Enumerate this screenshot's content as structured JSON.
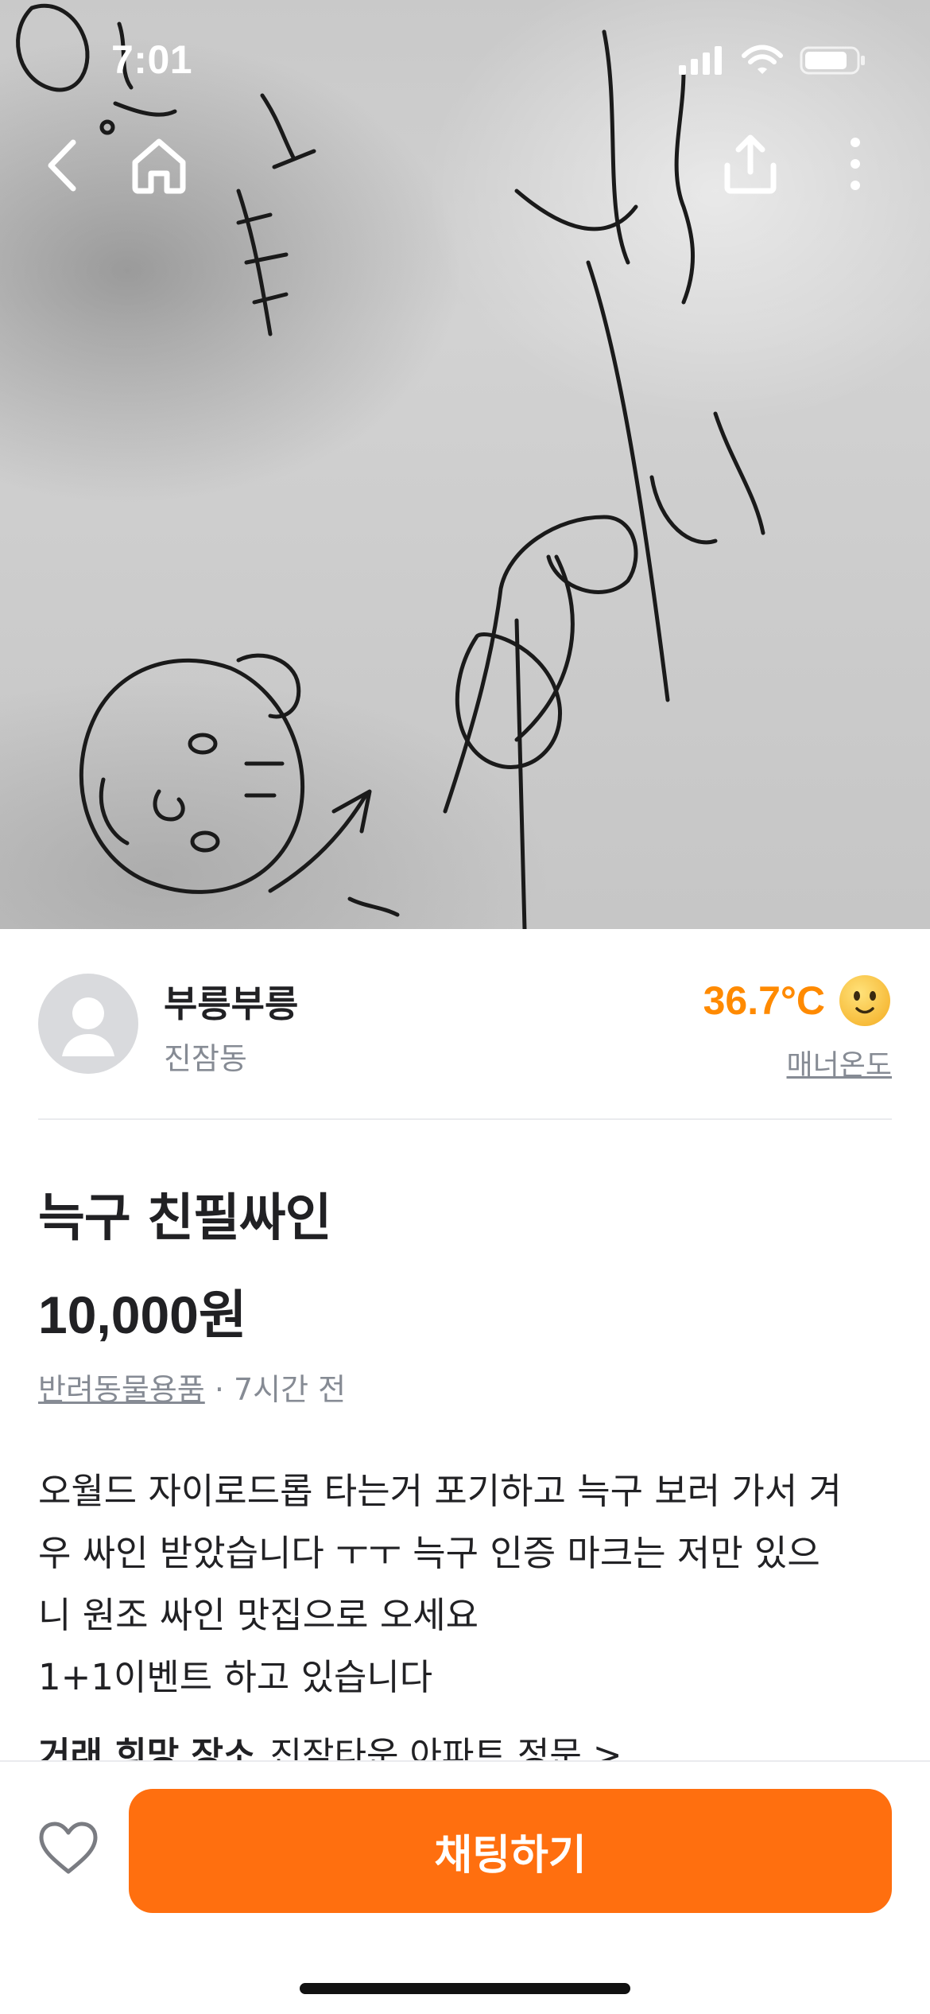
{
  "status_bar": {
    "time": "7:01"
  },
  "nav": {
    "back_icon": "chevron-left-icon",
    "home_icon": "home-icon",
    "share_icon": "share-icon",
    "more_icon": "more-vertical-icon"
  },
  "photo": {
    "description_icon": "product-photo"
  },
  "seller": {
    "name": "부릉부릉",
    "town": "진잠동",
    "manner_temp": "36.7°C",
    "manner_label": "매너온도"
  },
  "product": {
    "title": "늑구 친필싸인",
    "price": "10,000원",
    "category": "반려동물용품",
    "posted": " · 7시간 전",
    "description": "오월드 자이로드롭 타는거 포기하고 늑구 보러 가서 겨\n우 싸인 받았습니다 ㅜㅜ 늑구 인증 마크는 저만 있으\n니 원조 싸인 맛집으로 오세요\n1+1이벤트 하고 있습니다",
    "place_label": "거래 희망 장소",
    "place_value": "진잠타운 아파트 정문 >"
  },
  "bottom": {
    "chat_label": "채팅하기"
  },
  "colors": {
    "accent": "#ff6f0f",
    "temp": "#ff8a00",
    "muted": "#868b94"
  }
}
